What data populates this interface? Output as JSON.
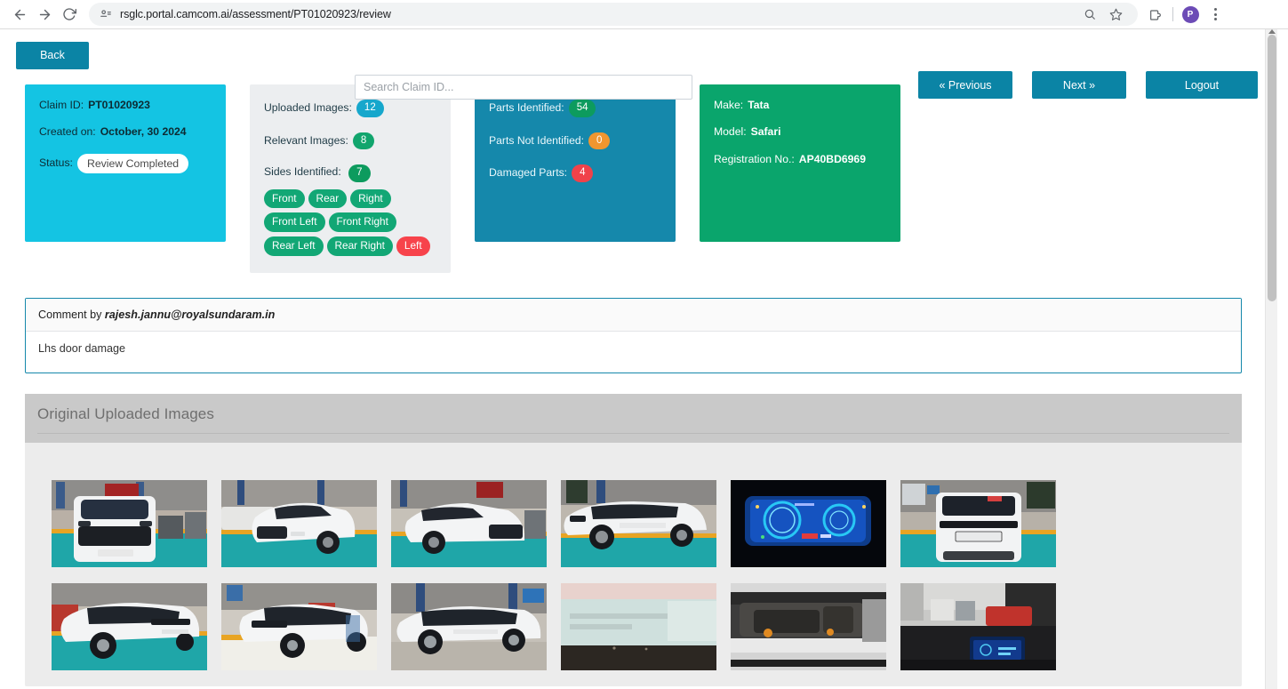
{
  "browser": {
    "url": "rsglc.portal.camcom.ai/assessment/PT01020923/review",
    "back_icon": "back-arrow-icon",
    "forward_icon": "forward-arrow-icon",
    "reload_icon": "reload-icon",
    "site_icon": "site-settings-icon",
    "zoom_icon": "zoom-icon",
    "bookmark_icon": "star-icon",
    "extensions_icon": "extensions-icon",
    "profile_initial": "P",
    "menu_icon": "kebab-menu-icon"
  },
  "toolbar": {
    "back_label": "Back",
    "previous_label": "« Previous",
    "next_label": "Next »",
    "logout_label": "Logout"
  },
  "search": {
    "placeholder": "Search Claim ID...",
    "value": ""
  },
  "cards": {
    "claim": {
      "claim_id_label": "Claim ID:",
      "claim_id_value": "PT01020923",
      "created_on_label": "Created on:",
      "created_on_value": "October, 30 2024",
      "status_label": "Status:",
      "status_value": "Review Completed",
      "bg_color": "#14c4e3"
    },
    "images": {
      "uploaded_label": "Uploaded Images:",
      "uploaded_value": "12",
      "relevant_label": "Relevant Images:",
      "relevant_value": "8",
      "sides_label": "Sides Identified:",
      "sides_value": "7",
      "sides": [
        {
          "label": "Front",
          "color": "green"
        },
        {
          "label": "Rear",
          "color": "green"
        },
        {
          "label": "Right",
          "color": "green"
        },
        {
          "label": "Front Left",
          "color": "green"
        },
        {
          "label": "Front Right",
          "color": "green"
        },
        {
          "label": "Rear Left",
          "color": "green"
        },
        {
          "label": "Rear Right",
          "color": "green"
        },
        {
          "label": "Left",
          "color": "red"
        }
      ],
      "bg_color": "#eceef0"
    },
    "parts": {
      "identified_label": "Parts Identified:",
      "identified_value": "54",
      "not_identified_label": "Parts Not Identified:",
      "not_identified_value": "0",
      "damaged_label": "Damaged Parts:",
      "damaged_value": "4",
      "bg_color": "#1588ab"
    },
    "vehicle": {
      "make_label": "Make:",
      "make_value": "Tata",
      "model_label": "Model:",
      "model_value": "Safari",
      "registration_label": "Registration No.:",
      "registration_value": "AP40BD6969",
      "bg_color": "#0aa56c"
    }
  },
  "comment": {
    "head_prefix": "Comment by ",
    "author": "rajesh.jannu@royalsundaram.in",
    "body": "Lhs door damage"
  },
  "gallery": {
    "title": "Original Uploaded Images",
    "thumbnails": [
      {
        "name": "front-view-white-suv-garage"
      },
      {
        "name": "front-left-three-quarter-white-suv"
      },
      {
        "name": "front-right-three-quarter-white-suv"
      },
      {
        "name": "left-side-white-suv-damage"
      },
      {
        "name": "instrument-cluster-display"
      },
      {
        "name": "rear-view-white-suv-plate"
      },
      {
        "name": "rear-left-three-quarter-white-suv"
      },
      {
        "name": "rear-right-three-quarter-white-suv"
      },
      {
        "name": "right-side-white-suv"
      },
      {
        "name": "blurred-document-closeup"
      },
      {
        "name": "engine-bay-open-bonnet"
      },
      {
        "name": "interior-dashboard-infotainment"
      }
    ]
  }
}
